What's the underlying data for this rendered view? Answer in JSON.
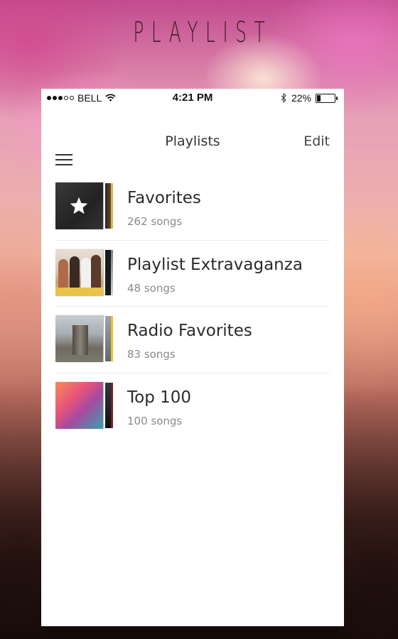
{
  "app": {
    "logo": "PLAYLIST"
  },
  "status_bar": {
    "carrier": "BELL",
    "time": "4:21 PM",
    "battery": "22%",
    "battery_level": 0.22,
    "signal_bars": 3
  },
  "nav": {
    "title": "Playlists",
    "edit_label": "Edit"
  },
  "playlists": [
    {
      "title": "Favorites",
      "subtitle": "262 songs",
      "icon": "star-icon"
    },
    {
      "title": "Playlist Extravaganza",
      "subtitle": "48 songs"
    },
    {
      "title": "Radio Favorites",
      "subtitle": "83 songs"
    },
    {
      "title": "Top 100",
      "subtitle": "100 songs"
    }
  ],
  "colors": {
    "text_primary": "#2b2b2b",
    "text_secondary": "#8a8a8a",
    "logo": "#3a1f22"
  }
}
